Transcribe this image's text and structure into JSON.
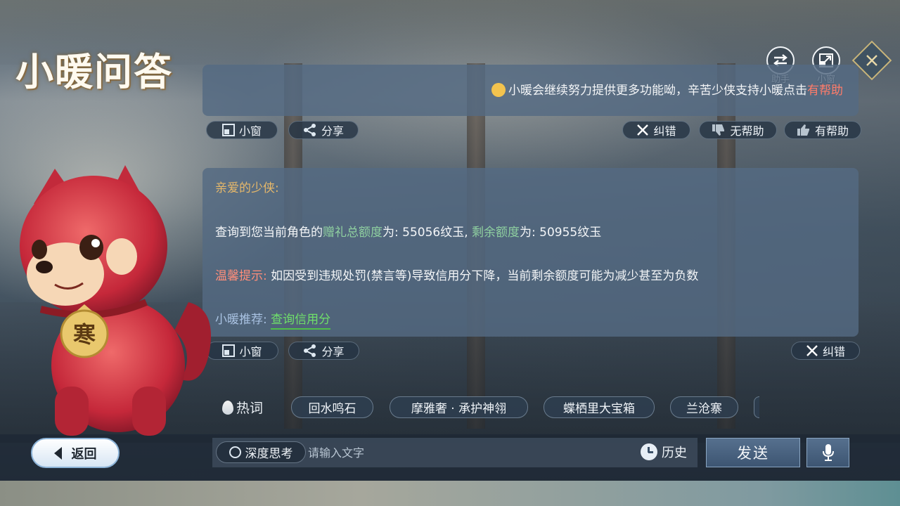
{
  "app": {
    "title": "小暖问答"
  },
  "top_actions": {
    "assistant_label": "助手",
    "mini_window_label": "小窗"
  },
  "answer1": {
    "text_prefix": "小暖会继续努力提供更多功能呦，辛苦少侠支持小暖点击",
    "text_highlight": "有帮助",
    "actions": {
      "mini_window": "小窗",
      "share": "分享",
      "correct": "纠错",
      "unhelpful": "无帮助",
      "helpful": "有帮助"
    }
  },
  "answer2": {
    "greeting": "亲爱的少侠:",
    "query_prefix": "查询到您当前角色的",
    "gift_total_label": "赠礼总额度",
    "gift_total_value": "为: 55056纹玉,",
    "remaining_label": "剩余额度",
    "remaining_value": "为: 50955纹玉",
    "tip_label": "温馨提示:",
    "tip_text": "如因受到违规处罚(禁言等)导致信用分下降，当前剩余额度可能为减少甚至为负数",
    "recommend_label": "小暖推荐:",
    "recommend_link": "查询信用分",
    "actions": {
      "mini_window": "小窗",
      "share": "分享",
      "correct": "纠错"
    }
  },
  "hot_words": {
    "label": "热词",
    "items": [
      "回水鸣石",
      "摩雅奢 · 承护神翎",
      "蝶栖里大宝箱",
      "兰沧寨"
    ]
  },
  "bottom": {
    "back_label": "返回",
    "deep_think_label": "深度思考",
    "input_placeholder": "请输入文字",
    "input_value": "",
    "history_label": "历史",
    "send_label": "发送"
  },
  "mascot": {
    "tag_text": "寒"
  },
  "colors": {
    "panel": "#546a82",
    "accent_green": "#8fd0a0",
    "accent_red": "#ff8e7a",
    "link_green": "#6fe06a",
    "greeting_gold": "#e6b86a"
  }
}
